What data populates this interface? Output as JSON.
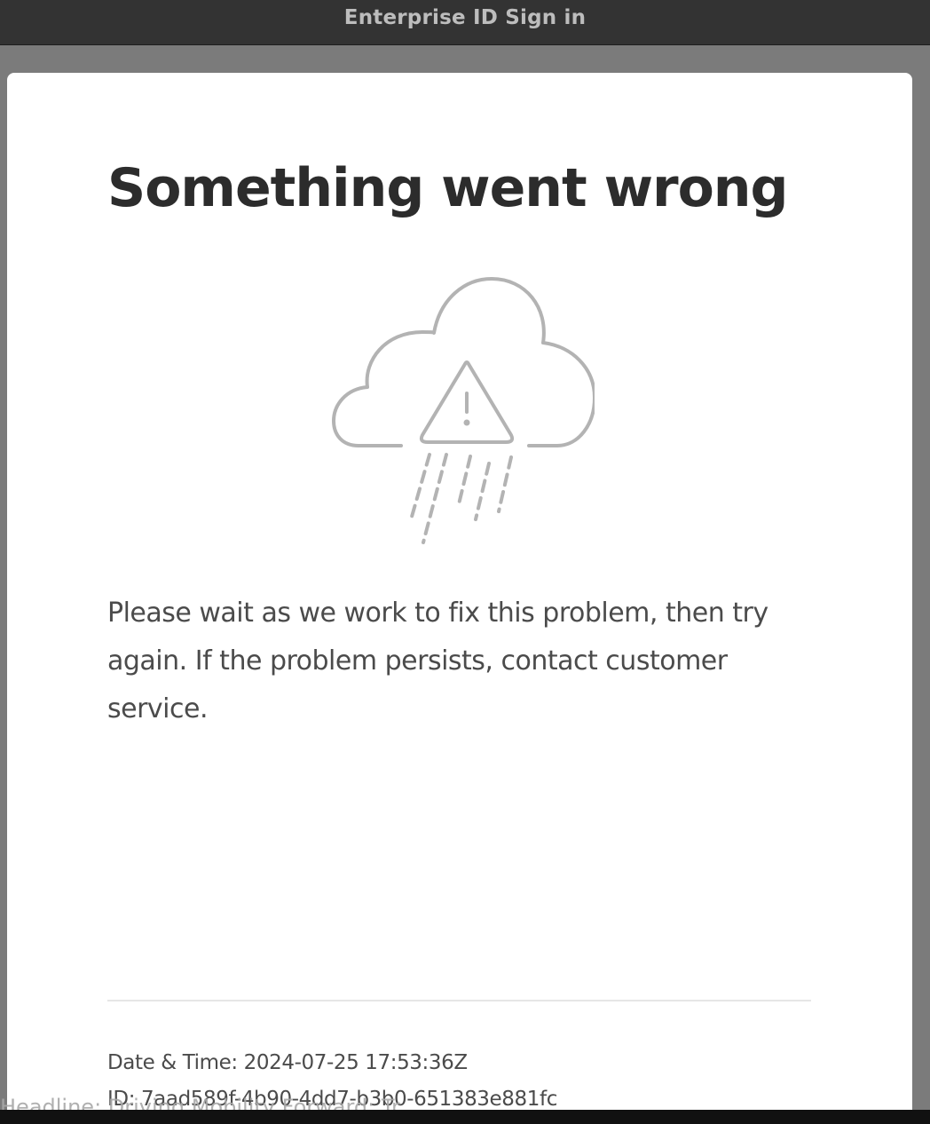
{
  "window": {
    "title": "Enterprise ID Sign in"
  },
  "error_page": {
    "heading": "Something went wrong",
    "illustration_icon": "cloud-warning-rain-icon",
    "message": "Please wait as we work to fix this problem, then try again. If the problem persists, contact customer service.",
    "date_time": "Date & Time: 2024-07-25 17:53:36Z",
    "id": "ID: 7aad589f-4b90-4dd7-b3b0-651383e881fc"
  },
  "background_overlay": {
    "text": "Headline: Driving Mobility Forward: Tr..."
  },
  "colors": {
    "titlebar_bg": "#333333",
    "titlebar_text": "#bdbdbd",
    "backdrop": "#7b7b7b",
    "card_bg": "#ffffff",
    "heading_text": "#2c2c2c",
    "body_text": "#4b4b4b",
    "icon_stroke": "#b3b3b3",
    "divider": "#e6e6e6"
  }
}
